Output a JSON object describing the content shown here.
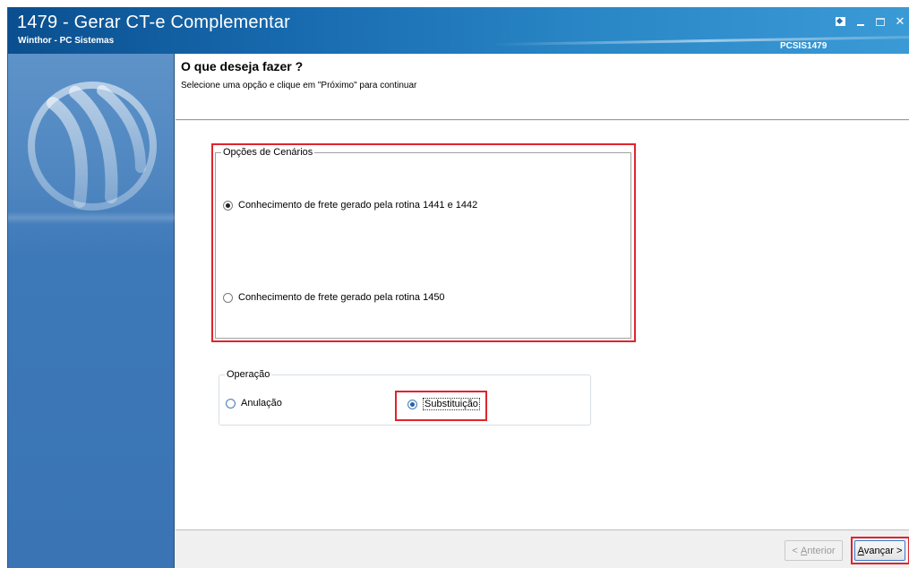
{
  "window": {
    "title": "1479 - Gerar CT-e Complementar",
    "subtitle": "Winthor - PC Sistemas",
    "code": "PCSIS1479"
  },
  "header": {
    "heading": "O que deseja fazer ?",
    "instruction": "Selecione uma opção e clique em \"Próximo\" para continuar"
  },
  "scenarios": {
    "legend": "Opções de Cenários",
    "options": [
      {
        "label": "Conhecimento de frete gerado pela rotina 1441 e 1442",
        "checked": true
      },
      {
        "label": "Conhecimento de frete gerado pela rotina 1450",
        "checked": false
      }
    ]
  },
  "operacao": {
    "legend": "Operação",
    "options": [
      {
        "label": "Anulação",
        "checked": false
      },
      {
        "label": "Substituição",
        "checked": true
      }
    ]
  },
  "footer": {
    "back_prefix": "< ",
    "back_accel": "A",
    "back_rest": "nterior",
    "next_accel": "A",
    "next_rest": "vançar >"
  },
  "colors": {
    "titlebar": "#1769ad",
    "sidebar": "#3d78b8",
    "highlight": "#e0242c"
  }
}
